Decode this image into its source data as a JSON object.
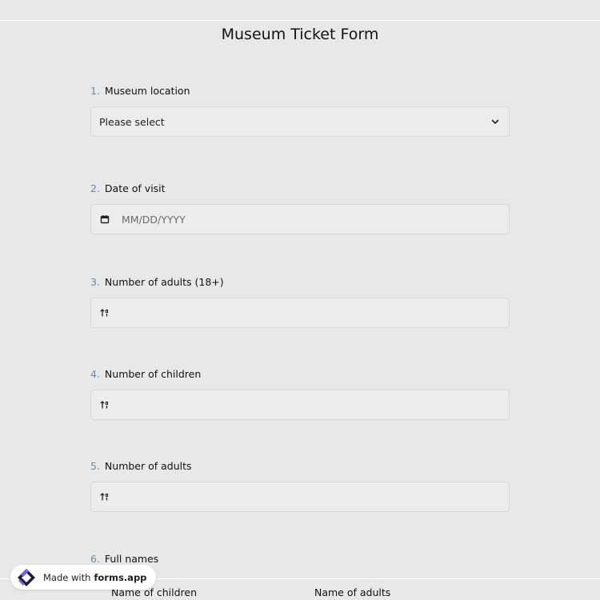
{
  "form": {
    "title": "Museum Ticket Form"
  },
  "questions": [
    {
      "number": "1.",
      "label": "Museum location",
      "type": "select",
      "value": "Please select",
      "icon": "chevron-down-icon"
    },
    {
      "number": "2.",
      "label": "Date of visit",
      "type": "date",
      "placeholder": "MM/DD/YYYY",
      "icon": "calendar-icon"
    },
    {
      "number": "3.",
      "label": "Number of adults (18+)",
      "type": "number",
      "icon": "sort-number-icon"
    },
    {
      "number": "4.",
      "label": "Number of children",
      "type": "number",
      "icon": "sort-number-icon"
    },
    {
      "number": "5.",
      "label": "Number of adults",
      "type": "number",
      "icon": "sort-number-icon"
    },
    {
      "number": "6.",
      "label": "Full names",
      "type": "table"
    }
  ],
  "full_names": {
    "columns": [
      "Name of children",
      "Name of adults"
    ]
  },
  "badge": {
    "prefix": "Made with",
    "brand": "forms.app"
  },
  "colors": {
    "background": "#e8e8e8",
    "field_background": "#ececec",
    "question_number": "#6f86a8",
    "badge_logo_dark": "#1d1d3a",
    "badge_logo_accent": "#7b5cf0"
  }
}
